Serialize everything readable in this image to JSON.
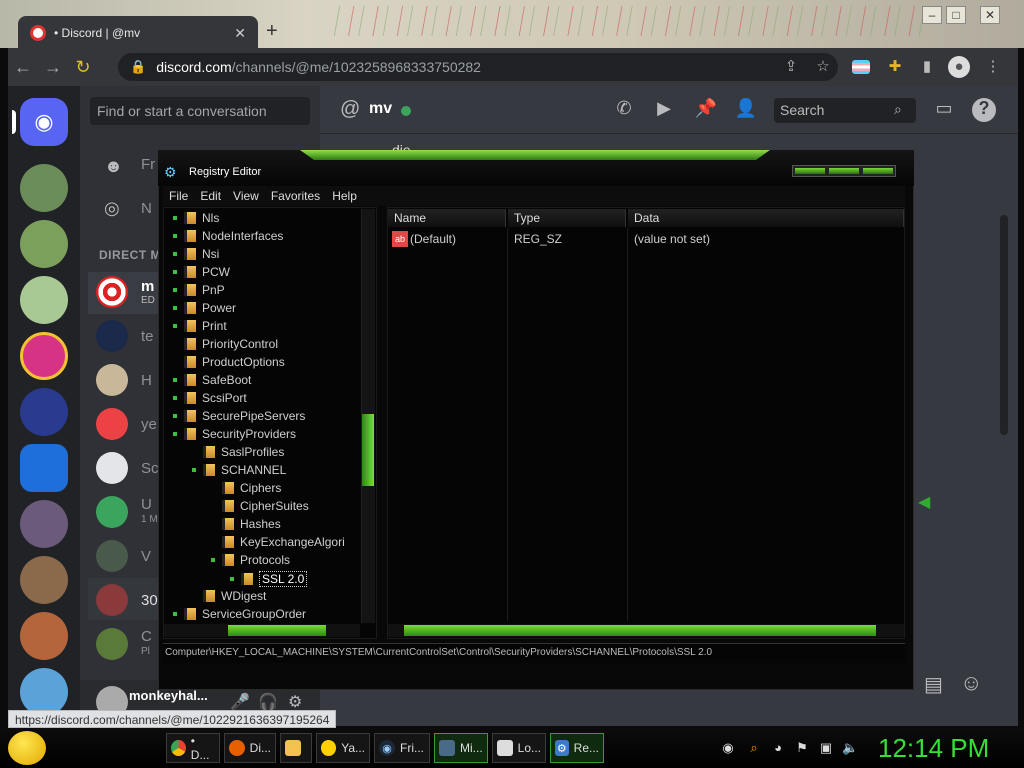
{
  "browser": {
    "tab_title": "• Discord | @mv",
    "url_host": "discord.com",
    "url_path": "/channels/@me/1023258968333750282",
    "status_url": "https://discord.com/channels/@me/1022921636397195264"
  },
  "discord": {
    "search_placeholder": "Find or start a conversation",
    "nav": [
      {
        "label": "Fr"
      },
      {
        "label": "N"
      }
    ],
    "direct_messages_header": "DIRECT M",
    "dms": [
      {
        "name": "m",
        "sub": "ED"
      },
      {
        "name": "te",
        "sub": ""
      },
      {
        "name": "H",
        "sub": ""
      },
      {
        "name": "ye",
        "sub": ""
      },
      {
        "name": "Sc",
        "sub": ""
      },
      {
        "name": "U",
        "sub": "1 M"
      },
      {
        "name": "V",
        "sub": ""
      },
      {
        "name": "30",
        "sub": ""
      },
      {
        "name": "C",
        "sub": "Pl"
      }
    ],
    "user_name": "monkeyhal...",
    "channel_name": "mv",
    "header_search": "Search",
    "chat_partial_text": "die",
    "icons": [
      "call-icon",
      "video-icon",
      "pin-icon",
      "add-friend-icon",
      "search-icon",
      "inbox-icon",
      "help-icon"
    ]
  },
  "registry": {
    "title": "Registry Editor",
    "menu": [
      "File",
      "Edit",
      "View",
      "Favorites",
      "Help"
    ],
    "tree": [
      {
        "label": "Nls"
      },
      {
        "label": "NodeInterfaces"
      },
      {
        "label": "Nsi"
      },
      {
        "label": "PCW"
      },
      {
        "label": "PnP"
      },
      {
        "label": "Power"
      },
      {
        "label": "Print"
      },
      {
        "label": "PriorityControl"
      },
      {
        "label": "ProductOptions"
      },
      {
        "label": "SafeBoot"
      },
      {
        "label": "ScsiPort"
      },
      {
        "label": "SecurePipeServers"
      },
      {
        "label": "SecurityProviders"
      },
      {
        "label": "SaslProfiles"
      },
      {
        "label": "SCHANNEL"
      },
      {
        "label": "Ciphers"
      },
      {
        "label": "CipherSuites"
      },
      {
        "label": "Hashes"
      },
      {
        "label": "KeyExchangeAlgori"
      },
      {
        "label": "Protocols"
      },
      {
        "label": "SSL 2.0"
      },
      {
        "label": "WDigest"
      },
      {
        "label": "ServiceGroupOrder"
      }
    ],
    "columns": [
      "Name",
      "Type",
      "Data"
    ],
    "values": [
      {
        "name": "(Default)",
        "type": "REG_SZ",
        "data": "(value not set)"
      }
    ],
    "status_path": "Computer\\HKEY_LOCAL_MACHINE\\SYSTEM\\CurrentControlSet\\Control\\SecurityProviders\\SCHANNEL\\Protocols\\SSL 2.0"
  },
  "taskbar": {
    "items": [
      {
        "label": "• D...",
        "icon": "chrome-icon"
      },
      {
        "label": "Di...",
        "icon": "firefox-icon"
      },
      {
        "label": "",
        "icon": "folder-icon"
      },
      {
        "label": "Ya...",
        "icon": "emoji-icon"
      },
      {
        "label": "Fri...",
        "icon": "steam-icon"
      },
      {
        "label": "Mi...",
        "icon": "app-icon"
      },
      {
        "label": "Lo...",
        "icon": "notepad-icon"
      },
      {
        "label": "Re...",
        "icon": "regedit-icon"
      }
    ],
    "clock": "12:14 PM"
  }
}
